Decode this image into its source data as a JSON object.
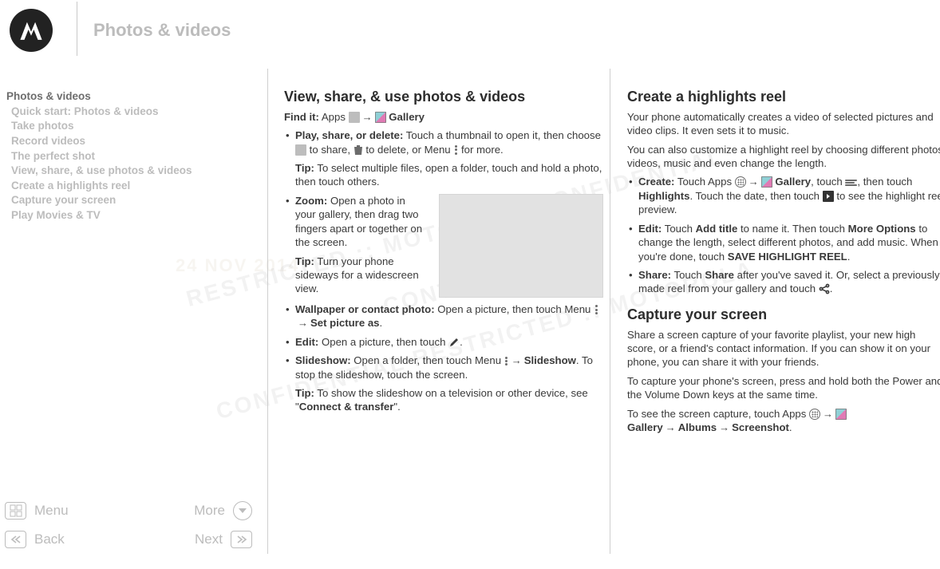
{
  "header": {
    "title": "Photos & videos"
  },
  "sidebar": {
    "items": [
      {
        "label": "Photos & videos",
        "active": true
      },
      {
        "label": "Quick start: Photos & videos"
      },
      {
        "label": "Take photos"
      },
      {
        "label": "Record videos"
      },
      {
        "label": "The perfect shot"
      },
      {
        "label": "View, share, & use photos & videos"
      },
      {
        "label": "Create a highlights reel"
      },
      {
        "label": "Capture your screen"
      },
      {
        "label": "Play Movies & TV"
      }
    ]
  },
  "bottomnav": {
    "menu": "Menu",
    "more": "More",
    "back": "Back",
    "next": "Next"
  },
  "watermark": {
    "lines": "RESTRICTED :: MOTOROLA CONFIDENTIAL\nCONTROLLED\nCONFIDENTIAL RESTRICTED :: MOTOROLA",
    "date": "24 NOV 2014"
  },
  "col1": {
    "h": "View, share, & use photos & videos",
    "findit_label": "Find it:",
    "findit_apps": " Apps ",
    "findit_gallery": "Gallery",
    "play_title": "Play, share, or delete:",
    "play_body": " Touch a thumbnail to open it, then choose ",
    "play_share": " to share, ",
    "play_delete": " to delete, or Menu ",
    "play_more": " for more.",
    "play_tip_label": "Tip:",
    "play_tip_body": " To select multiple files, open a folder, touch and hold a photo, then touch others.",
    "zoom_title": "Zoom:",
    "zoom_body": " Open a photo in your gallery, then drag two fingers apart or together on the screen.",
    "zoom_tip_label": "Tip:",
    "zoom_tip_body": " Turn your phone sideways for a widescreen view.",
    "wall_title": "Wallpaper or contact photo:",
    "wall_body": " Open a picture, then touch Menu ",
    "wall_action": "Set picture as",
    "edit_title": "Edit:",
    "edit_body": " Open a picture, then touch ",
    "slide_title": "Slideshow:",
    "slide_body": " Open a folder, then touch Menu ",
    "slide_action": "Slideshow",
    "slide_stop": ". To stop the slideshow, touch the screen.",
    "slide_tip_label": "Tip:",
    "slide_tip_body_a": " To show the slideshow on a television or other device, see \"",
    "slide_tip_link": "Connect & transfer",
    "slide_tip_body_b": "\"."
  },
  "col2": {
    "h1": "Create a highlights reel",
    "p1": "Your phone automatically creates a video of selected pictures and video clips. It even sets it to music.",
    "p2": "You can also customize a highlight reel by choosing different photos, videos, music and even change the length.",
    "create_title": "Create:",
    "create_a": " Touch Apps ",
    "create_gal": "Gallery",
    "create_b": ", touch ",
    "create_c": ", then touch ",
    "create_highlights": "Highlights",
    "create_d": ". Touch the date, then touch ",
    "create_e": " to see the highlight reel preview.",
    "edit_title": "Edit:",
    "edit_a": " Touch ",
    "edit_addtitle": "Add title",
    "edit_b": " to name it. Then touch ",
    "edit_more": "More Options",
    "edit_c": " to change the length, select different photos, and add music. When you're done, touch ",
    "edit_save": "SAVE HIGHLIGHT REEL",
    "edit_d": ".",
    "share_title": "Share:",
    "share_a": " Touch ",
    "share_word": "Share",
    "share_b": " after you've saved it. Or, select a previously made reel from your gallery and touch ",
    "share_c": ".",
    "h2": "Capture your screen",
    "cap_p1": "Share a screen capture of your favorite playlist, your new high score, or a friend's contact information. If you can show it on your phone, you can share it with your friends.",
    "cap_p2": "To capture your phone's screen, press and hold both the Power and the Volume Down keys at the same time.",
    "cap_p3a": "To see the screen capture, touch Apps ",
    "cap_gal": "Gallery",
    "cap_albums": "Albums",
    "cap_ss": "Screenshot",
    "cap_p3b": "."
  }
}
